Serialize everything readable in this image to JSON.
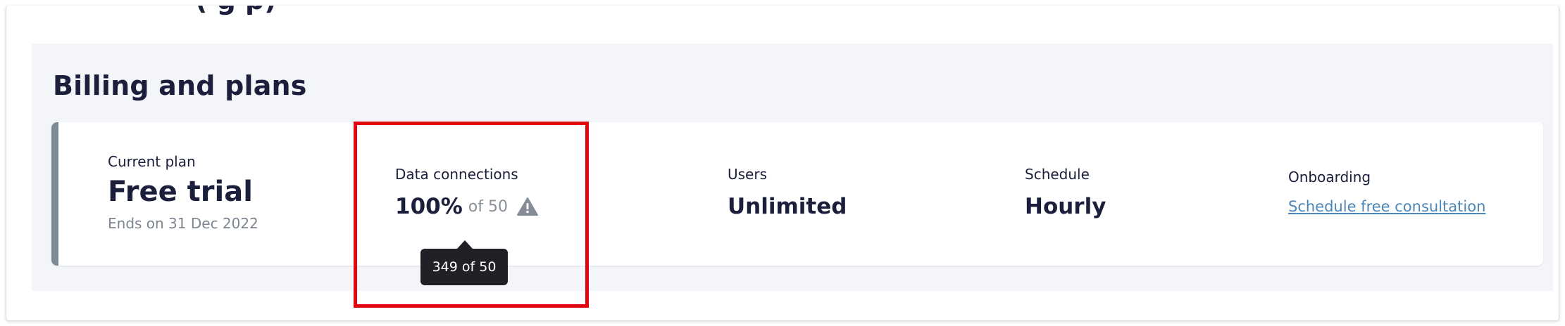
{
  "section": {
    "title": "Billing and plans"
  },
  "plan": {
    "label": "Current plan",
    "name": "Free trial",
    "ends": "Ends on 31 Dec 2022"
  },
  "data_connections": {
    "label": "Data connections",
    "percent": "100%",
    "of_total": "of 50",
    "usage_fraction": 1.0,
    "warning_icon": "warning-triangle-icon",
    "tooltip": "349 of 50"
  },
  "users": {
    "label": "Users",
    "value": "Unlimited"
  },
  "schedule": {
    "label": "Schedule",
    "value": "Hourly"
  },
  "onboarding": {
    "label": "Onboarding",
    "link": "Schedule free consultation"
  },
  "colors": {
    "highlight": "#e0070e",
    "accent_bar": "#7b8a96",
    "link": "#4a86b8",
    "tooltip_bg": "#1f2126"
  }
}
